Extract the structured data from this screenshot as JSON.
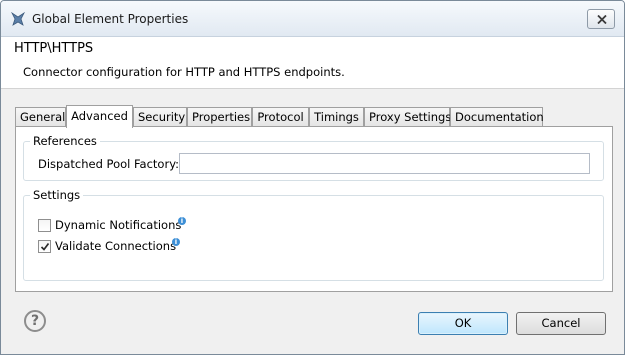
{
  "window": {
    "title": "Global Element Properties"
  },
  "banner": {
    "title": "HTTP\\HTTPS",
    "description": "Connector configuration for HTTP and HTTPS endpoints."
  },
  "tabs": [
    {
      "label": "General",
      "active": false
    },
    {
      "label": "Advanced",
      "active": true
    },
    {
      "label": "Security",
      "active": false
    },
    {
      "label": "Properties",
      "active": false
    },
    {
      "label": "Protocol",
      "active": false
    },
    {
      "label": "Timings",
      "active": false
    },
    {
      "label": "Proxy Settings",
      "active": false
    },
    {
      "label": "Documentation",
      "active": false
    }
  ],
  "references": {
    "group_label": "References",
    "pool_factory_label": "Dispatched Pool Factory:",
    "pool_factory_value": ""
  },
  "settings": {
    "group_label": "Settings",
    "dynamic_notifications": {
      "label": "Dynamic Notifications",
      "checked": false
    },
    "validate_connections": {
      "label": "Validate Connections",
      "checked": true
    }
  },
  "footer": {
    "ok_label": "OK",
    "cancel_label": "Cancel",
    "help_icon": "?"
  }
}
